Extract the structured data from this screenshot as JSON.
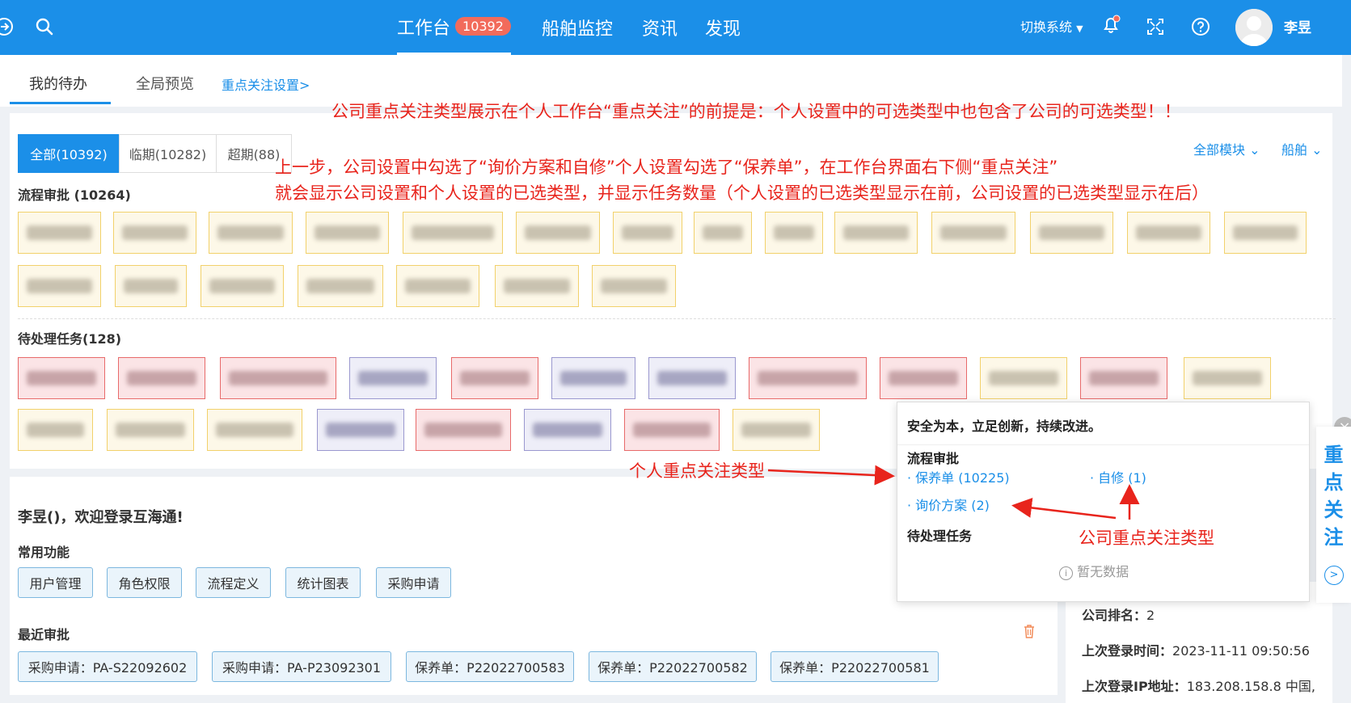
{
  "topbar": {
    "nav": [
      {
        "label": "工作台",
        "badge": "10392"
      },
      {
        "label": "船舶监控"
      },
      {
        "label": "资讯"
      },
      {
        "label": "发现"
      }
    ],
    "switch_system": "切换系统",
    "username": "李昱"
  },
  "tabs": {
    "my_todo": "我的待办",
    "global_preview": "全局预览",
    "focus_settings_link": "重点关注设置>"
  },
  "filters": {
    "segments": [
      "全部(10392)",
      "临期(10282)",
      "超期(88)"
    ],
    "all_modules": "全部模块",
    "ship": "船舶"
  },
  "sections": {
    "process_approval": "流程审批 (10264)",
    "pending_tasks": "待处理任务(128)"
  },
  "welcome": {
    "greeting": "李昱()，欢迎登录互海通!",
    "common_functions": "常用功能",
    "functions": [
      "用户管理",
      "角色权限",
      "流程定义",
      "统计图表",
      "采购申请"
    ],
    "recent_approvals": "最近审批",
    "approvals": [
      "采购申请：PA-S22092602",
      "采购申请：PA-P23092301",
      "保养单：P22022700583",
      "保养单：P22022700582",
      "保养单：P22022700581"
    ]
  },
  "right_info": {
    "company_rank_label": "公司排名：",
    "company_rank_value": "2",
    "last_login_time_label": "上次登录时间：",
    "last_login_time_value": "2023-11-11 09:50:56",
    "last_login_ip_label": "上次登录IP地址：",
    "last_login_ip_value": "183.208.158.8 中国,"
  },
  "popup": {
    "slogan": "安全为本，立足创新，持续改进。",
    "process_approval": "流程审批",
    "items": [
      "保养单 (10225)",
      "自修 (1)",
      "询价方案 (2)"
    ],
    "pending_tasks": "待处理任务",
    "empty": "暂无数据"
  },
  "side_tab": {
    "chars": [
      "重",
      "点",
      "关",
      "注"
    ],
    "arrow": ">"
  },
  "annotations": {
    "line1": "公司重点关注类型展示在个人工作台“重点关注”的前提是：个人设置中的可选类型中也包含了公司的可选类型！！",
    "line2": "上一步，公司设置中勾选了“询价方案和自修”个人设置勾选了“保养单”，在工作台界面右下侧“重点关注”",
    "line3": "就会显示公司设置和个人设置的已选类型，并显示任务数量（个人设置的已选类型显示在前，公司设置的已选类型显示在后）",
    "personal_label": "个人重点关注类型",
    "company_label": "公司重点关注类型"
  },
  "colors": {
    "brand": "#1b8fe8",
    "annotation": "#e8241c",
    "badge": "#f26b5b"
  }
}
